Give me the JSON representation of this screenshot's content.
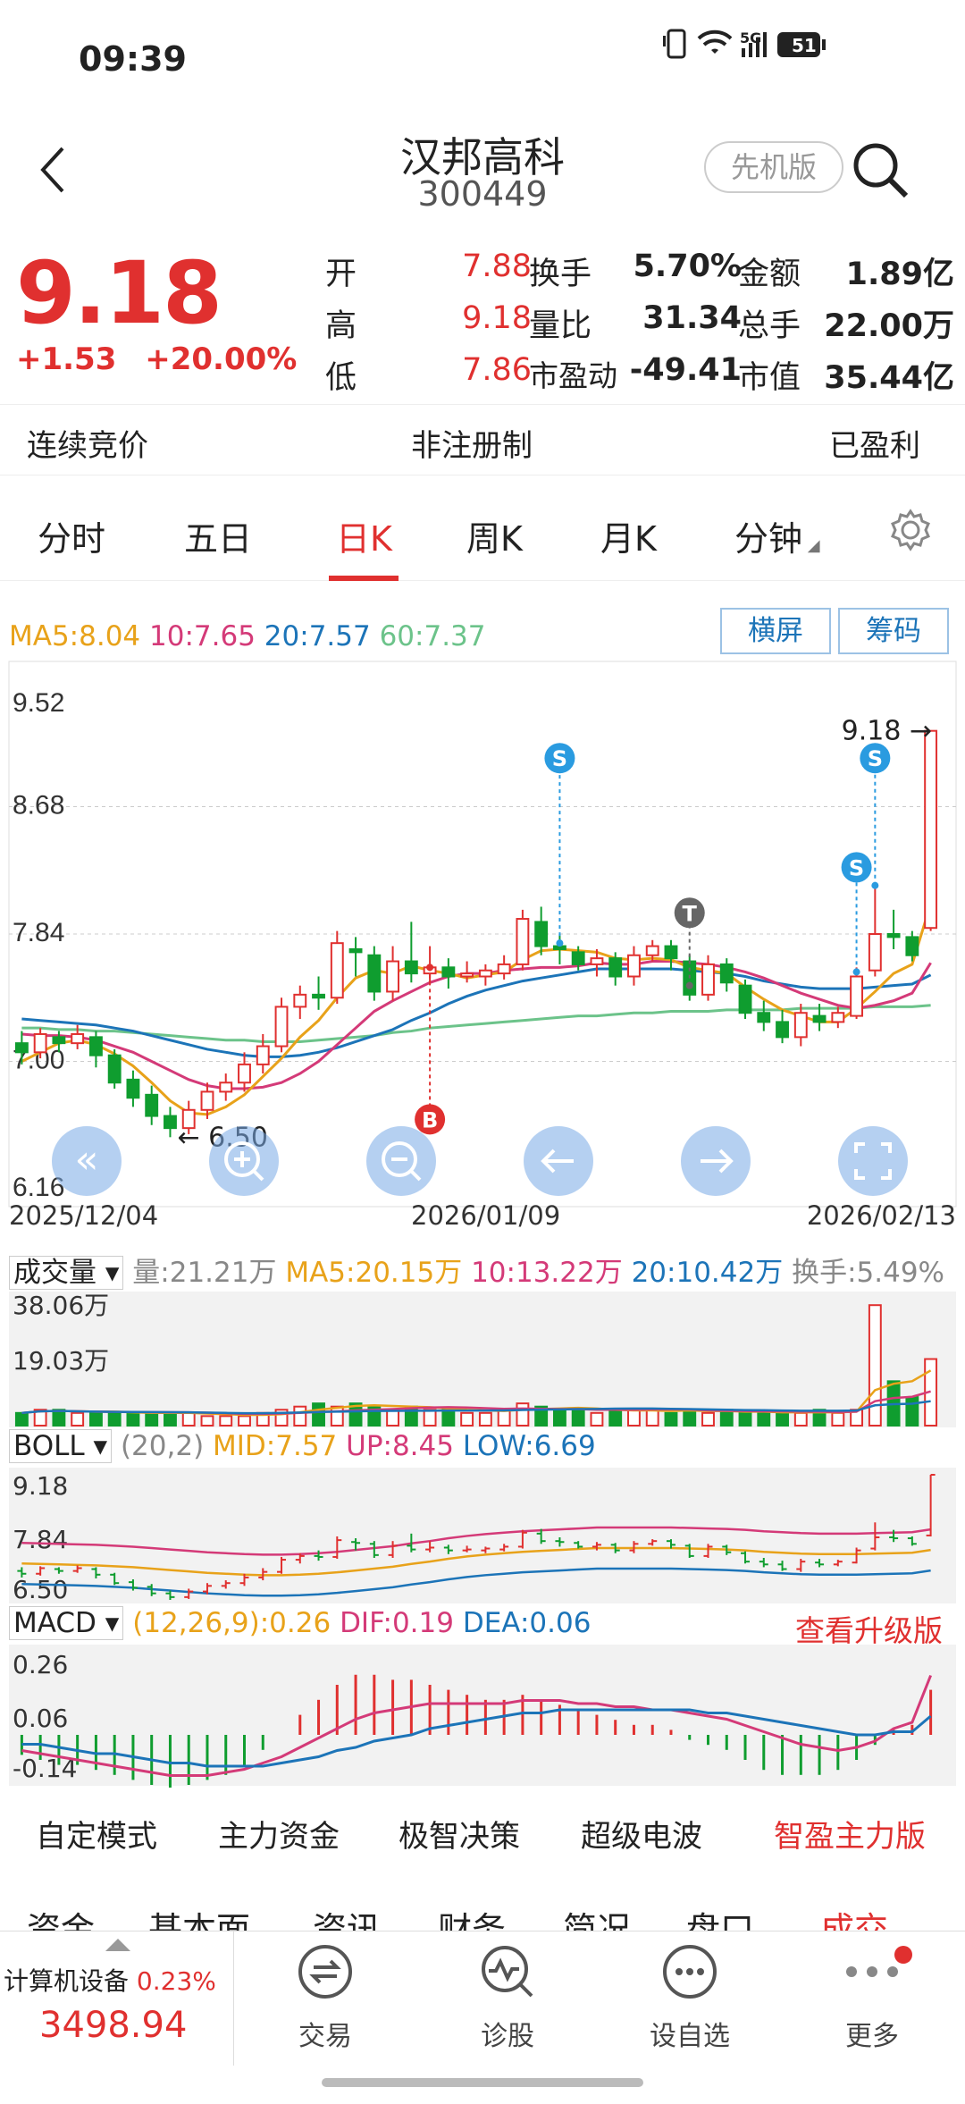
{
  "status": {
    "time": "09:39",
    "network": "5G",
    "battery": "51"
  },
  "header": {
    "title": "汉邦高科",
    "code": "300449",
    "version_btn": "先机版"
  },
  "quote": {
    "price": "9.18",
    "change": "+1.53",
    "change_pct": "+20.00%",
    "rows": [
      {
        "l1": "开",
        "v1": "7.88",
        "l2": "换手",
        "v2": "5.70%",
        "l3": "金额",
        "v3": "1.89亿"
      },
      {
        "l1": "高",
        "v1": "9.18",
        "l2": "量比",
        "v2": "31.34",
        "l3": "总手",
        "v3": "22.00万"
      },
      {
        "l1": "低",
        "v1": "7.86",
        "l2": "市盈动",
        "v2": "-49.41",
        "l3": "市值",
        "v3": "35.44亿"
      }
    ]
  },
  "flags": {
    "a": "连续竞价",
    "b": "非注册制",
    "c": "已盈利"
  },
  "tabs": [
    "分时",
    "五日",
    "日K",
    "周K",
    "月K",
    "分钟"
  ],
  "active_tab": "日K",
  "ma": {
    "ma5": "MA5:8.04",
    "ma10": "10:7.65",
    "ma20": "20:7.57",
    "ma60": "60:7.37"
  },
  "chart_buttons": {
    "landscape": "横屏",
    "chips": "筹码"
  },
  "colors": {
    "up": "#e0302f",
    "down": "#0f9d2f",
    "ma5": "#e8a21a",
    "ma10": "#d43a78",
    "ma20": "#1c74b8",
    "ma60": "#6cc38a"
  },
  "chart_data": [
    {
      "type": "candlestick",
      "title": "日K",
      "ylim": [
        6.16,
        9.52
      ],
      "y_ticks": [
        "9.52",
        "8.68",
        "7.84",
        "7.00",
        "6.16"
      ],
      "x_labels": [
        "2025/12/04",
        "2026/01/09",
        "2026/02/13"
      ],
      "annotations": {
        "high": "9.18",
        "low": "6.50"
      },
      "markers": [
        "B",
        "S",
        "T",
        "S",
        "S"
      ],
      "candles": [
        [
          7.12,
          7.06,
          7.2,
          6.98
        ],
        [
          7.06,
          7.18,
          7.22,
          7.02
        ],
        [
          7.16,
          7.12,
          7.2,
          7.06
        ],
        [
          7.12,
          7.18,
          7.24,
          7.08
        ],
        [
          7.16,
          7.04,
          7.2,
          6.96
        ],
        [
          7.04,
          6.86,
          7.08,
          6.82
        ],
        [
          6.88,
          6.76,
          6.94,
          6.7
        ],
        [
          6.78,
          6.64,
          6.84,
          6.58
        ],
        [
          6.64,
          6.56,
          6.7,
          6.5
        ],
        [
          6.56,
          6.68,
          6.74,
          6.52
        ],
        [
          6.68,
          6.8,
          6.86,
          6.62
        ],
        [
          6.8,
          6.86,
          6.92,
          6.74
        ],
        [
          6.86,
          6.98,
          7.06,
          6.8
        ],
        [
          6.98,
          7.1,
          7.18,
          6.92
        ],
        [
          7.1,
          7.36,
          7.42,
          7.06
        ],
        [
          7.36,
          7.44,
          7.5,
          7.28
        ],
        [
          7.44,
          7.42,
          7.56,
          7.34
        ],
        [
          7.42,
          7.78,
          7.86,
          7.38
        ],
        [
          7.74,
          7.72,
          7.82,
          7.56
        ],
        [
          7.7,
          7.46,
          7.76,
          7.4
        ],
        [
          7.46,
          7.66,
          7.76,
          7.4
        ],
        [
          7.66,
          7.58,
          7.92,
          7.52
        ],
        [
          7.58,
          7.62,
          7.76,
          7.52
        ],
        [
          7.62,
          7.56,
          7.68,
          7.48
        ],
        [
          7.56,
          7.58,
          7.66,
          7.52
        ],
        [
          7.56,
          7.6,
          7.64,
          7.5
        ],
        [
          7.58,
          7.64,
          7.7,
          7.54
        ],
        [
          7.64,
          7.94,
          8.0,
          7.6
        ],
        [
          7.92,
          7.76,
          8.02,
          7.7
        ],
        [
          7.76,
          7.74,
          7.84,
          7.64
        ],
        [
          7.72,
          7.64,
          7.76,
          7.6
        ],
        [
          7.64,
          7.68,
          7.74,
          7.56
        ],
        [
          7.68,
          7.56,
          7.72,
          7.5
        ],
        [
          7.56,
          7.7,
          7.76,
          7.5
        ],
        [
          7.7,
          7.76,
          7.8,
          7.66
        ],
        [
          7.76,
          7.68,
          7.8,
          7.6
        ],
        [
          7.66,
          7.44,
          7.7,
          7.4
        ],
        [
          7.44,
          7.64,
          7.7,
          7.4
        ],
        [
          7.64,
          7.52,
          7.68,
          7.46
        ],
        [
          7.5,
          7.32,
          7.54,
          7.28
        ],
        [
          7.32,
          7.26,
          7.4,
          7.2
        ],
        [
          7.26,
          7.16,
          7.34,
          7.12
        ],
        [
          7.16,
          7.32,
          7.38,
          7.1
        ],
        [
          7.3,
          7.26,
          7.38,
          7.2
        ],
        [
          7.26,
          7.32,
          7.36,
          7.22
        ],
        [
          7.3,
          7.56,
          7.62,
          7.28
        ],
        [
          7.6,
          7.84,
          8.16,
          7.56
        ],
        [
          7.84,
          7.82,
          8.0,
          7.74
        ],
        [
          7.82,
          7.7,
          7.86,
          7.66
        ],
        [
          7.88,
          9.18,
          9.18,
          7.86
        ]
      ],
      "ma5": [
        7.0,
        7.06,
        7.12,
        7.14,
        7.11,
        7.05,
        6.97,
        6.86,
        6.74,
        6.66,
        6.65,
        6.7,
        6.78,
        6.9,
        7.02,
        7.16,
        7.27,
        7.42,
        7.55,
        7.6,
        7.58,
        7.63,
        7.6,
        7.58,
        7.55,
        7.57,
        7.59,
        7.67,
        7.73,
        7.74,
        7.73,
        7.72,
        7.68,
        7.67,
        7.68,
        7.67,
        7.62,
        7.6,
        7.58,
        7.49,
        7.41,
        7.34,
        7.3,
        7.26,
        7.26,
        7.35,
        7.46,
        7.58,
        7.64,
        8.04
      ],
      "ma10": [
        7.18,
        7.17,
        7.17,
        7.16,
        7.14,
        7.1,
        7.06,
        7.0,
        6.94,
        6.88,
        6.84,
        6.82,
        6.82,
        6.83,
        6.86,
        6.92,
        7.0,
        7.11,
        7.22,
        7.33,
        7.4,
        7.46,
        7.52,
        7.56,
        7.58,
        7.58,
        7.6,
        7.61,
        7.62,
        7.62,
        7.63,
        7.65,
        7.64,
        7.64,
        7.66,
        7.66,
        7.65,
        7.64,
        7.62,
        7.59,
        7.55,
        7.5,
        7.45,
        7.41,
        7.37,
        7.35,
        7.37,
        7.4,
        7.45,
        7.65
      ],
      "ma20": [
        7.28,
        7.27,
        7.26,
        7.25,
        7.24,
        7.22,
        7.2,
        7.17,
        7.14,
        7.11,
        7.08,
        7.06,
        7.04,
        7.03,
        7.03,
        7.04,
        7.06,
        7.09,
        7.13,
        7.17,
        7.21,
        7.27,
        7.32,
        7.38,
        7.43,
        7.47,
        7.5,
        7.53,
        7.55,
        7.57,
        7.59,
        7.61,
        7.61,
        7.61,
        7.61,
        7.61,
        7.6,
        7.59,
        7.58,
        7.56,
        7.53,
        7.51,
        7.49,
        7.48,
        7.48,
        7.48,
        7.49,
        7.5,
        7.51,
        7.57
      ],
      "ma60": [
        7.22,
        7.22,
        7.21,
        7.21,
        7.2,
        7.2,
        7.19,
        7.18,
        7.17,
        7.16,
        7.15,
        7.14,
        7.14,
        7.13,
        7.13,
        7.13,
        7.14,
        7.15,
        7.16,
        7.17,
        7.19,
        7.2,
        7.22,
        7.23,
        7.24,
        7.25,
        7.26,
        7.27,
        7.28,
        7.29,
        7.3,
        7.3,
        7.31,
        7.32,
        7.32,
        7.33,
        7.33,
        7.33,
        7.34,
        7.34,
        7.34,
        7.34,
        7.35,
        7.35,
        7.35,
        7.35,
        7.36,
        7.36,
        7.36,
        7.37
      ]
    },
    {
      "type": "bar",
      "title": "成交量",
      "legend": {
        "vol": "量:21.21万",
        "ma5": "MA5:20.15万",
        "ma10": "10:13.22万",
        "ma20": "20:10.42万",
        "turnover": "换手:5.49%"
      },
      "y_ticks": [
        "38.06万",
        "19.03万"
      ],
      "ylim": [
        0,
        38.06
      ],
      "values": [
        4,
        5,
        5,
        4,
        4,
        4,
        4,
        4,
        4,
        4,
        3,
        3,
        3,
        4,
        5,
        6,
        7,
        6,
        7,
        6,
        5,
        6,
        5,
        5,
        4,
        4,
        5,
        7,
        6,
        5,
        5,
        4,
        5,
        5,
        5,
        4,
        5,
        4,
        5,
        4,
        4,
        4,
        4,
        5,
        4,
        5,
        38,
        14,
        9,
        21
      ]
    },
    {
      "type": "line",
      "title": "BOLL",
      "legend": {
        "param": "(20,2)",
        "mid": "MID:7.57",
        "up": "UP:8.45",
        "low": "LOW:6.69"
      },
      "y_ticks": [
        "9.18",
        "7.84",
        "6.50"
      ],
      "ylim": [
        6.5,
        9.18
      ]
    },
    {
      "type": "bar",
      "title": "MACD",
      "legend": {
        "param": "(12,26,9):0.26",
        "dif": "DIF:0.19",
        "dea": "DEA:0.06"
      },
      "y_ticks": [
        "0.26",
        "0.06",
        "-0.14"
      ],
      "ylim": [
        -0.14,
        0.26
      ],
      "upgrade": "查看升级版",
      "hist": [
        -0.04,
        -0.05,
        -0.06,
        -0.06,
        -0.07,
        -0.08,
        -0.09,
        -0.1,
        -0.11,
        -0.1,
        -0.09,
        -0.08,
        -0.06,
        -0.03,
        0.0,
        0.04,
        0.07,
        0.1,
        0.12,
        0.12,
        0.11,
        0.11,
        0.1,
        0.09,
        0.08,
        0.07,
        0.07,
        0.08,
        0.07,
        0.06,
        0.05,
        0.04,
        0.03,
        0.02,
        0.02,
        0.01,
        -0.01,
        -0.02,
        -0.03,
        -0.05,
        -0.07,
        -0.08,
        -0.08,
        -0.08,
        -0.07,
        -0.05,
        -0.02,
        0.01,
        0.02,
        0.09
      ],
      "dif": [
        -0.05,
        -0.06,
        -0.07,
        -0.08,
        -0.09,
        -0.1,
        -0.11,
        -0.12,
        -0.13,
        -0.13,
        -0.13,
        -0.12,
        -0.11,
        -0.09,
        -0.07,
        -0.04,
        -0.01,
        0.02,
        0.05,
        0.07,
        0.08,
        0.09,
        0.1,
        0.1,
        0.1,
        0.1,
        0.1,
        0.11,
        0.11,
        0.11,
        0.1,
        0.1,
        0.09,
        0.09,
        0.08,
        0.08,
        0.07,
        0.06,
        0.05,
        0.03,
        0.01,
        -0.01,
        -0.03,
        -0.04,
        -0.05,
        -0.04,
        -0.02,
        0.02,
        0.04,
        0.19
      ],
      "dea": [
        -0.03,
        -0.03,
        -0.04,
        -0.05,
        -0.06,
        -0.06,
        -0.07,
        -0.08,
        -0.09,
        -0.09,
        -0.1,
        -0.1,
        -0.1,
        -0.1,
        -0.09,
        -0.08,
        -0.07,
        -0.05,
        -0.04,
        -0.02,
        -0.01,
        0.0,
        0.02,
        0.03,
        0.04,
        0.05,
        0.06,
        0.07,
        0.07,
        0.08,
        0.08,
        0.08,
        0.08,
        0.08,
        0.08,
        0.08,
        0.08,
        0.07,
        0.07,
        0.06,
        0.05,
        0.04,
        0.03,
        0.02,
        0.01,
        0.0,
        0.0,
        0.01,
        0.01,
        0.06
      ]
    }
  ],
  "bottom_menu": [
    "自定模式",
    "主力资金",
    "极智决策",
    "超级电波",
    "智盈主力版"
  ],
  "tabs2": [
    "资金",
    "基本面",
    "资讯",
    "财务",
    "简况",
    "盘口",
    "成交"
  ],
  "index": {
    "name": "计算机设备",
    "pct": "0.23%",
    "value": "3498.94"
  },
  "nav": [
    "交易",
    "诊股",
    "设自选",
    "更多"
  ]
}
